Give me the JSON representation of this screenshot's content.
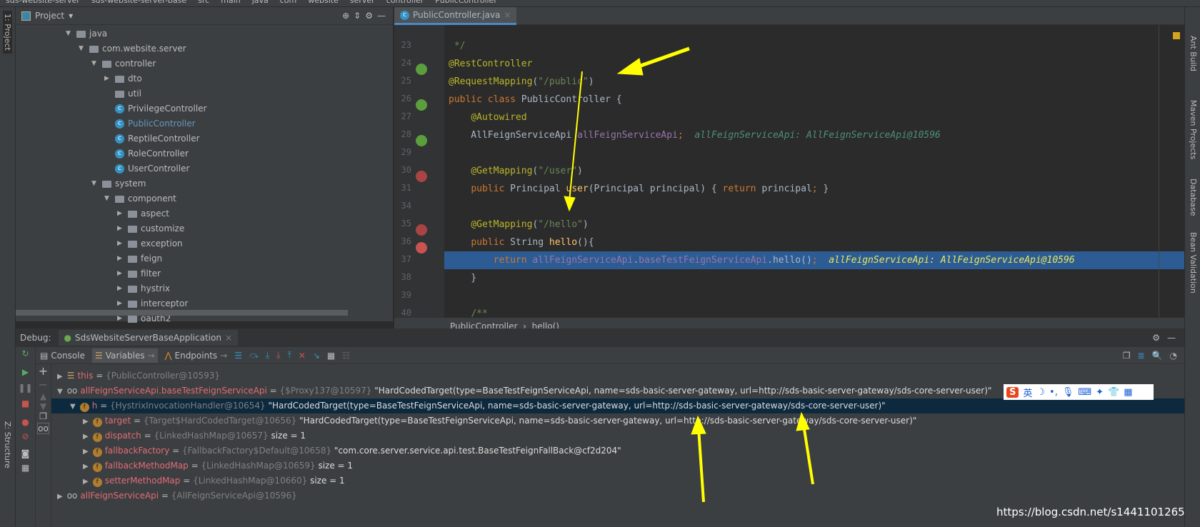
{
  "breadcrumb": [
    "sds-website-server",
    "sds-website-server-base",
    "src",
    "main",
    "java",
    "com",
    "website",
    "server",
    "controller",
    "PublicController"
  ],
  "left_strip": {
    "project": "1: Project",
    "structure": "Z: Structure"
  },
  "right_strip": [
    "Ant Build",
    "Maven Projects",
    "Database",
    "Bean Validation"
  ],
  "project": {
    "title": "Project",
    "tree": [
      {
        "label": "java",
        "depth": 0,
        "type": "folder",
        "open": true
      },
      {
        "label": "com.website.server",
        "depth": 1,
        "type": "folder",
        "open": true
      },
      {
        "label": "controller",
        "depth": 2,
        "type": "folder",
        "open": true
      },
      {
        "label": "dto",
        "depth": 3,
        "type": "folder",
        "open": false
      },
      {
        "label": "util",
        "depth": 3,
        "type": "folder",
        "leaf": true
      },
      {
        "label": "PrivilegeController",
        "depth": 3,
        "type": "class"
      },
      {
        "label": "PublicController",
        "depth": 3,
        "type": "class",
        "selected": true
      },
      {
        "label": "ReptileController",
        "depth": 3,
        "type": "class"
      },
      {
        "label": "RoleController",
        "depth": 3,
        "type": "class"
      },
      {
        "label": "UserController",
        "depth": 3,
        "type": "class"
      },
      {
        "label": "system",
        "depth": 2,
        "type": "folder",
        "open": true
      },
      {
        "label": "component",
        "depth": 3,
        "type": "folder",
        "open": true
      },
      {
        "label": "aspect",
        "depth": 4,
        "type": "folder"
      },
      {
        "label": "customize",
        "depth": 4,
        "type": "folder"
      },
      {
        "label": "exception",
        "depth": 4,
        "type": "folder"
      },
      {
        "label": "feign",
        "depth": 4,
        "type": "folder"
      },
      {
        "label": "filter",
        "depth": 4,
        "type": "folder"
      },
      {
        "label": "hystrix",
        "depth": 4,
        "type": "folder"
      },
      {
        "label": "interceptor",
        "depth": 4,
        "type": "folder"
      },
      {
        "label": "oauth2",
        "depth": 4,
        "type": "folder"
      }
    ]
  },
  "editor": {
    "tab": "PublicController.java",
    "footer": [
      "PublicController",
      "hello()"
    ],
    "lines": [
      {
        "n": "23",
        "html": " <span class=str>*/</span>"
      },
      {
        "n": "24",
        "html": "<span class=ann>@RestController</span>"
      },
      {
        "n": "25",
        "html": "<span class=ann>@RequestMapping</span>(<span class=str>\"/public\"</span>)"
      },
      {
        "n": "26",
        "html": "<span class=kw>public class</span> PublicController {"
      },
      {
        "n": "27",
        "html": "    <span class=ann>@Autowired</span>"
      },
      {
        "n": "28",
        "html": "    AllFeignServiceApi <span class=fld>allFeignServiceApi</span><span class=kw>;</span>  <span class=hint>allFeignServiceApi: AllFeignServiceApi@10596</span>"
      },
      {
        "n": "29",
        "html": ""
      },
      {
        "n": "30",
        "html": "    <span class=ann>@GetMapping</span>(<span class=str>\"/user\"</span>)"
      },
      {
        "n": "31",
        "html": "    <span class=kw>public</span> Principal <span class=fn>user</span>(Principal principal) { <span class=kw>return</span> principal<span class=kw>;</span> }"
      },
      {
        "n": "34",
        "html": ""
      },
      {
        "n": "35",
        "html": "    <span class=ann>@GetMapping</span>(<span class=str>\"/hello\"</span>)"
      },
      {
        "n": "36",
        "html": "    <span class=kw>public</span> String <span class=fn>hello</span>(){"
      },
      {
        "n": "37",
        "html": "        <span class=kw>return</span> <span class=fld>allFeignServiceApi</span>.<span class=fld>baseTestFeignServiceApi</span>.hello()<span class=kw>;</span>  <span class=hint2>allFeignServiceApi: AllFeignServiceApi@10596</span>",
        "current": true
      },
      {
        "n": "38",
        "html": "    }"
      },
      {
        "n": "39",
        "html": ""
      },
      {
        "n": "40",
        "html": "    <span class=str>/**</span>"
      }
    ]
  },
  "debug": {
    "label": "Debug:",
    "session": "SdsWebsiteServerBaseApplication",
    "tabs": {
      "console": "Console",
      "variables": "Variables",
      "endpoints": "Endpoints"
    },
    "vars": [
      {
        "indent": 0,
        "icon": "list",
        "name": "this",
        "type": "{PublicController@10593}",
        "value": ""
      },
      {
        "indent": 0,
        "icon": "oo",
        "open": true,
        "name": "allFeignServiceApi.baseTestFeignServiceApi",
        "type": "{$Proxy137@10597}",
        "value": "\"HardCodedTarget(type=BaseTestFeignServiceApi, name=sds-basic-server-gateway, url=http://sds-basic-server-gateway/sds-core-server-user)\""
      },
      {
        "indent": 1,
        "icon": "f",
        "open": true,
        "selected": true,
        "name": "h",
        "type": "{HystrixInvocationHandler@10654}",
        "value": "\"HardCodedTarget(type=BaseTestFeignServiceApi, name=sds-basic-server-gateway, url=http://sds-basic-server-gateway/sds-core-server-user)\""
      },
      {
        "indent": 2,
        "icon": "f",
        "name": "target",
        "type": "{Target$HardCodedTarget@10656}",
        "value": "\"HardCodedTarget(type=BaseTestFeignServiceApi, name=sds-basic-server-gateway, url=http://sds-basic-server-gateway/sds-core-server-user)\""
      },
      {
        "indent": 2,
        "icon": "f",
        "name": "dispatch",
        "type": "{LinkedHashMap@10657}",
        "value": " size = 1"
      },
      {
        "indent": 2,
        "icon": "f",
        "name": "fallbackFactory",
        "type": "{FallbackFactory$Default@10658}",
        "value": "\"com.core.server.service.api.test.BaseTestFeignFallBack@cf2d204\""
      },
      {
        "indent": 2,
        "icon": "f",
        "name": "fallbackMethodMap",
        "type": "{LinkedHashMap@10659}",
        "value": " size = 1"
      },
      {
        "indent": 2,
        "icon": "f",
        "name": "setterMethodMap",
        "type": "{LinkedHashMap@10660}",
        "value": " size = 1"
      },
      {
        "indent": 0,
        "icon": "oo",
        "name": "allFeignServiceApi",
        "type": "{AllFeignServiceApi@10596}",
        "value": ""
      }
    ]
  },
  "ime": {
    "lang": "英"
  },
  "watermark": "https://blog.csdn.net/s1441101265",
  "colors": {
    "accent": "#4a88c7",
    "current_line": "#2d5c94",
    "annotation_arrow": "#ffff00"
  }
}
